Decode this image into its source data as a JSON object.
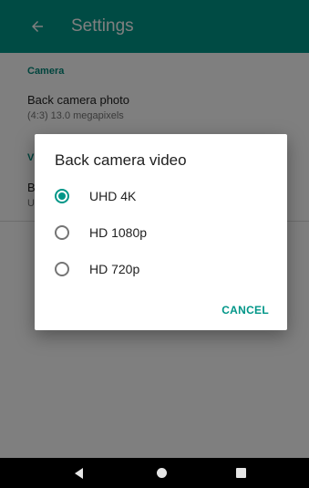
{
  "colors": {
    "accent": "#009688",
    "scrim": "rgba(0,0,0,0.5)",
    "navbar": "#000000"
  },
  "appbar": {
    "title": "Settings",
    "back_icon": "arrow-left-icon"
  },
  "settings": {
    "camera_category": "Camera",
    "back_photo_title": "Back camera photo",
    "back_photo_summary": "(4:3) 13.0 megapixels",
    "video_category_partial": "V",
    "back_video_title_partial": "B",
    "back_video_summary_partial": "U"
  },
  "dialog": {
    "title": "Back camera video",
    "options": [
      {
        "label": "UHD 4K",
        "selected": true
      },
      {
        "label": "HD 1080p",
        "selected": false
      },
      {
        "label": "HD 720p",
        "selected": false
      }
    ],
    "cancel_label": "CANCEL"
  },
  "navbar": {
    "icons": [
      "back-triangle-icon",
      "home-circle-icon",
      "recents-square-icon"
    ]
  }
}
